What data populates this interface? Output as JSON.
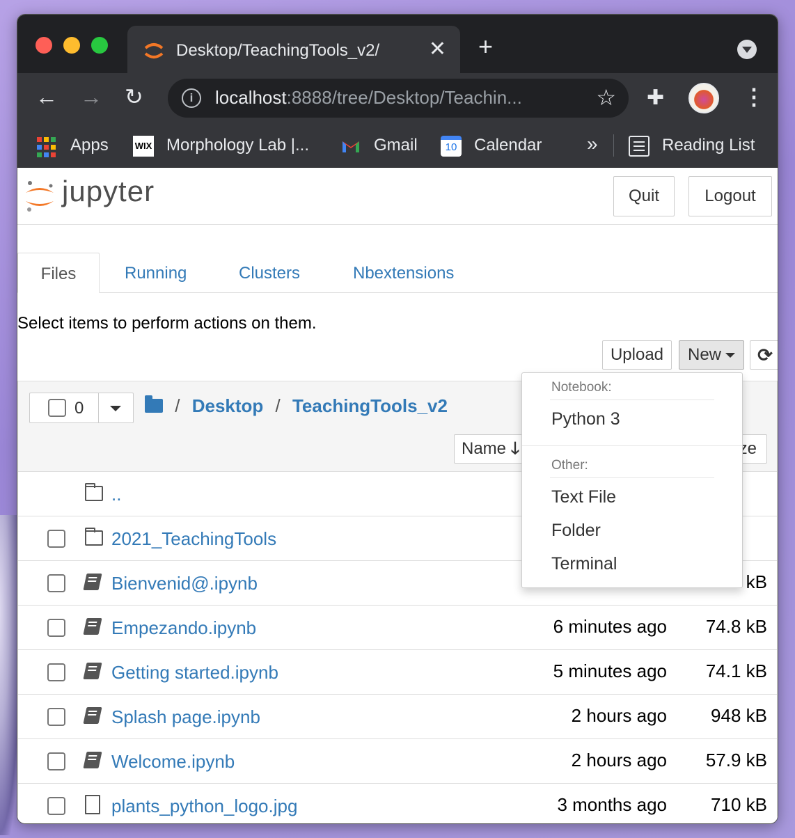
{
  "browser": {
    "tab_title": "Desktop/TeachingTools_v2/",
    "tab_close": "✕",
    "new_tab": "+",
    "url_host": "localhost",
    "url_rest": ":8888/tree/Desktop/Teachin...",
    "bookmarks": {
      "apps": "Apps",
      "wix_icon": "WIX",
      "morphology": "Morphology Lab |...",
      "gmail": "Gmail",
      "calendar_icon": "10",
      "calendar": "Calendar",
      "more": "»",
      "reading_list": "Reading List"
    }
  },
  "jupyter": {
    "logo_text": "jupyter",
    "quit": "Quit",
    "logout": "Logout",
    "tabs": [
      "Files",
      "Running",
      "Clusters",
      "Nbextensions"
    ],
    "hint": "Select items to perform actions on them.",
    "upload": "Upload",
    "new": "New",
    "selected_count": "0",
    "breadcrumb": [
      "Desktop",
      "TeachingTools_v2"
    ],
    "sort_name": "Name",
    "sort_size": "ze"
  },
  "files": [
    {
      "name": "..",
      "type": "folder",
      "modified": "",
      "size": "",
      "checkbox": false
    },
    {
      "name": "2021_TeachingTools",
      "type": "folder",
      "modified": "",
      "size": "",
      "checkbox": true
    },
    {
      "name": "Bienvenid@.ipynb",
      "type": "notebook",
      "modified": "",
      "size": "kB",
      "checkbox": true
    },
    {
      "name": "Empezando.ipynb",
      "type": "notebook",
      "modified": "6 minutes ago",
      "size": "74.8 kB",
      "checkbox": true
    },
    {
      "name": "Getting started.ipynb",
      "type": "notebook",
      "modified": "5 minutes ago",
      "size": "74.1 kB",
      "checkbox": true
    },
    {
      "name": "Splash page.ipynb",
      "type": "notebook",
      "modified": "2 hours ago",
      "size": "948 kB",
      "checkbox": true
    },
    {
      "name": "Welcome.ipynb",
      "type": "notebook",
      "modified": "2 hours ago",
      "size": "57.9 kB",
      "checkbox": true
    },
    {
      "name": "plants_python_logo.jpg",
      "type": "file",
      "modified": "3 months ago",
      "size": "710 kB",
      "checkbox": true
    }
  ],
  "new_menu": {
    "notebook_header": "Notebook:",
    "python": "Python 3",
    "other_header": "Other:",
    "text_file": "Text File",
    "folder": "Folder",
    "terminal": "Terminal"
  }
}
